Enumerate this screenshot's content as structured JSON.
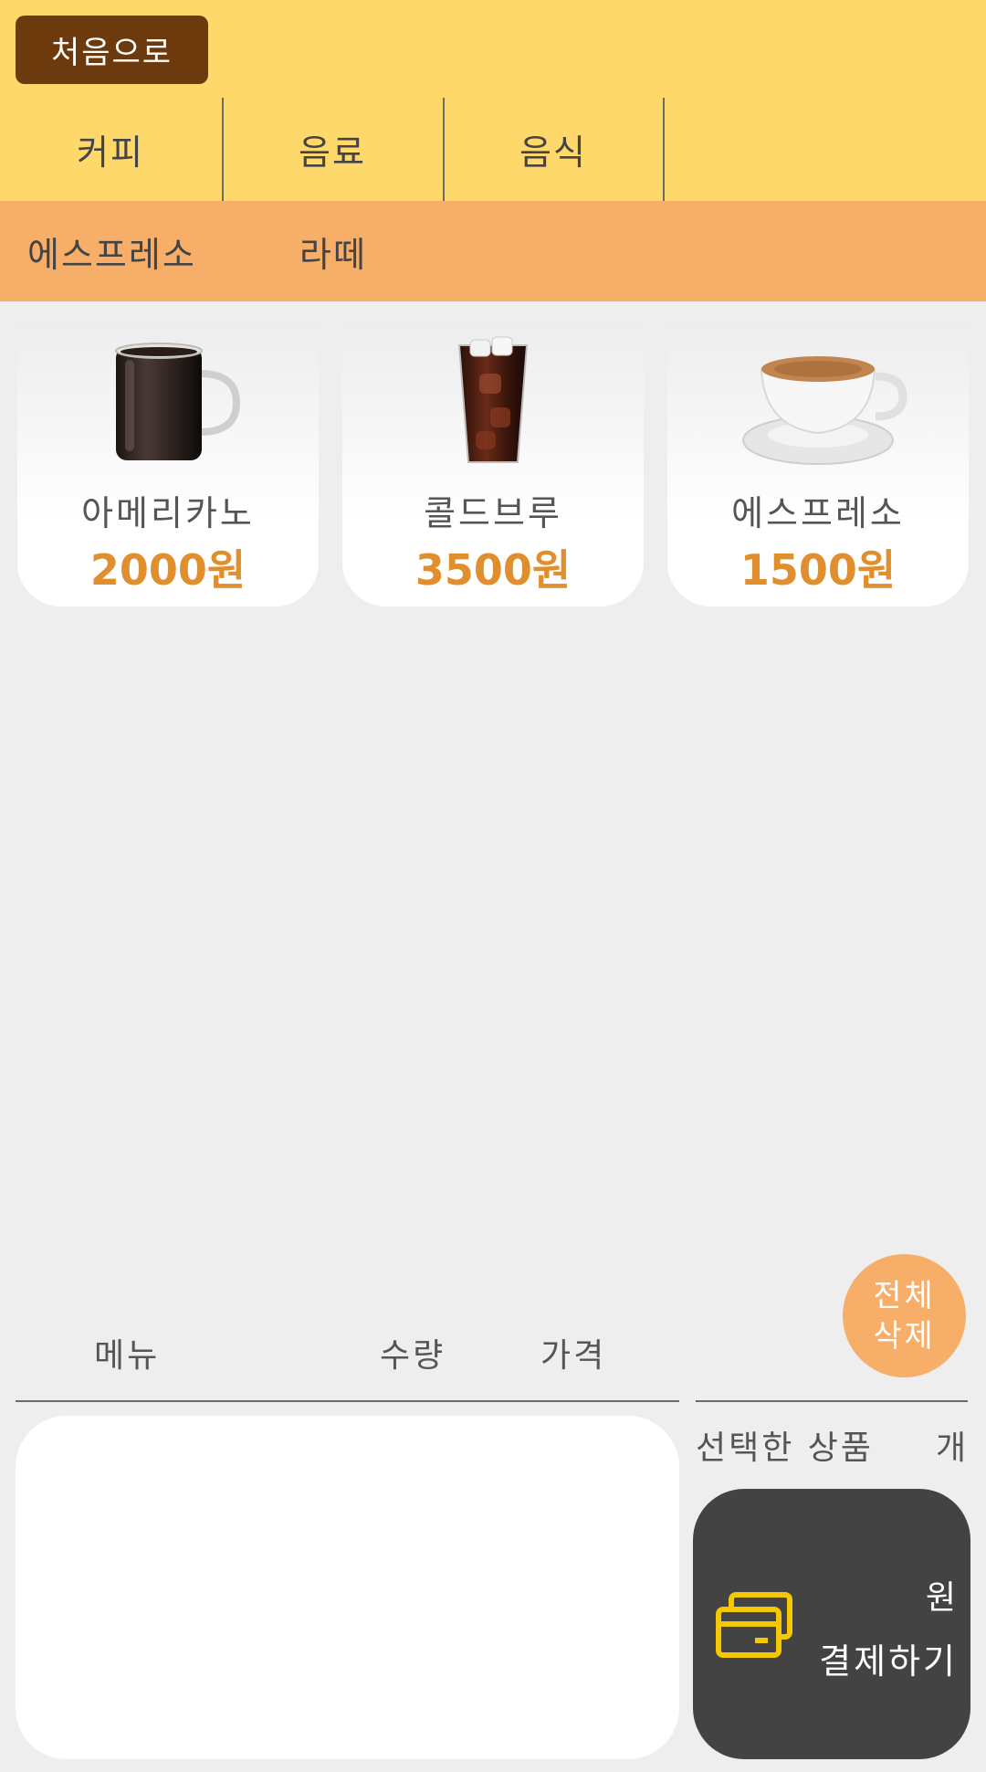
{
  "header": {
    "home_button": "처음으로",
    "categories": [
      "커피",
      "음료",
      "음식"
    ]
  },
  "subcategories": [
    "에스프레소",
    "라떼"
  ],
  "products": [
    {
      "name": "아메리카노",
      "price": "2000원",
      "image": "hot-coffee-mug"
    },
    {
      "name": "콜드브루",
      "price": "3500원",
      "image": "iced-coffee-glass"
    },
    {
      "name": "에스프레소",
      "price": "1500원",
      "image": "espresso-cup"
    }
  ],
  "clear_button": {
    "line1": "전체",
    "line2": "삭제"
  },
  "order_list": {
    "col_menu": "메뉴",
    "col_qty": "수량",
    "col_price": "가격"
  },
  "summary": {
    "selected_label": "선택한 상품",
    "count_unit": "개",
    "won": "원",
    "pay_label": "결제하기"
  },
  "colors": {
    "header": "#fed86b",
    "subbar": "#f6ae69",
    "home_button": "#6c3a0c",
    "price": "#e08e2e",
    "pay_panel": "#434343",
    "card_icon": "#f5c800"
  }
}
